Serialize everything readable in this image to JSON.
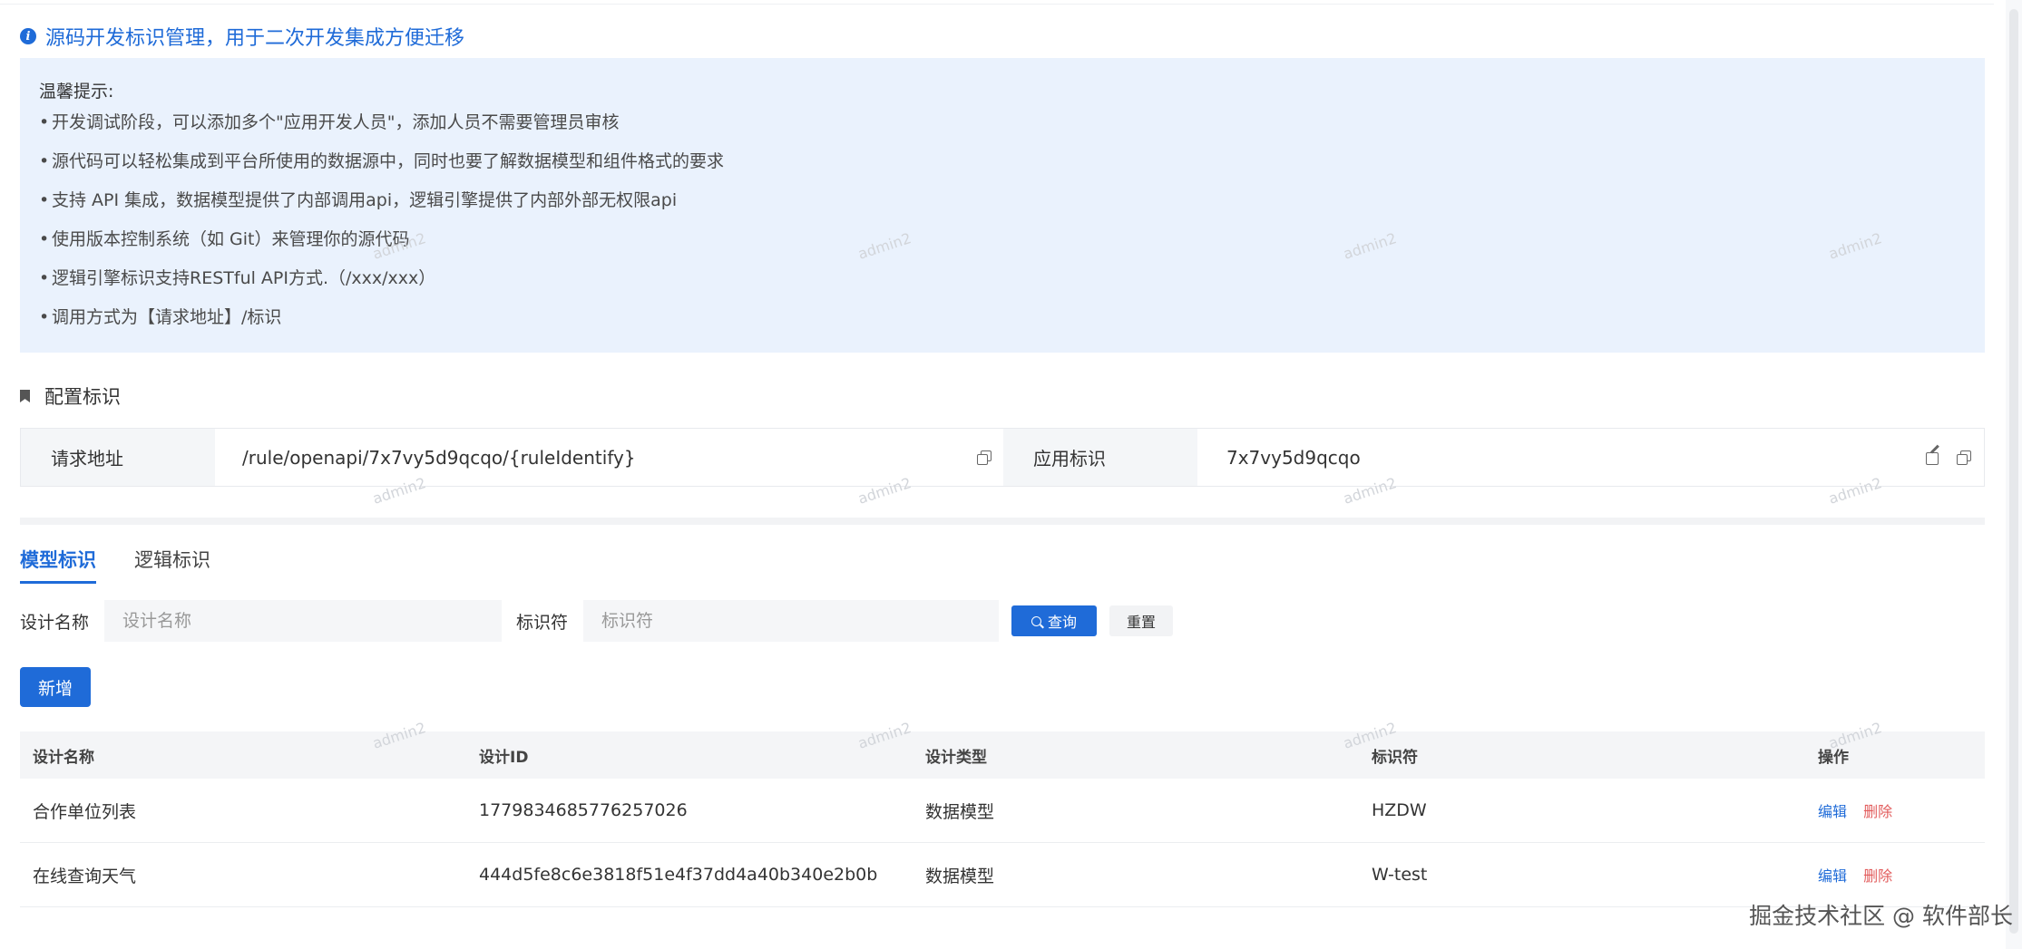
{
  "header": {
    "title": "源码开发标识管理，用于二次开发集成方便迁移"
  },
  "tips": {
    "title": "温馨提示:",
    "bullet": "•",
    "items": [
      "开发调试阶段，可以添加多个\"应用开发人员\"，添加人员不需要管理员审核",
      "源代码可以轻松集成到平台所使用的数据源中，同时也要了解数据模型和组件格式的要求",
      "支持 API 集成，数据模型提供了内部调用api，逻辑引擎提供了内部外部无权限api",
      "使用版本控制系统（如 Git）来管理你的源代码",
      "逻辑引擎标识支持RESTful API方式.（/xxx/xxx）",
      "调用方式为【请求地址】/标识"
    ]
  },
  "config": {
    "section_title": "配置标识",
    "request_label": "请求地址",
    "request_value": "/rule/openapi/7x7vy5d9qcqo/{ruleIdentify}",
    "app_label": "应用标识",
    "app_value": "7x7vy5d9qcqo"
  },
  "tabs": [
    {
      "label": "模型标识",
      "active": true
    },
    {
      "label": "逻辑标识",
      "active": false
    }
  ],
  "filter": {
    "name_label": "设计名称",
    "name_placeholder": "设计名称",
    "id_label": "标识符",
    "id_placeholder": "标识符",
    "query_label": "查询",
    "reset_label": "重置"
  },
  "add_label": "新增",
  "table": {
    "headers": [
      "设计名称",
      "设计ID",
      "设计类型",
      "标识符",
      "操作"
    ],
    "rows": [
      {
        "name": "合作单位列表",
        "id": "1779834685776257026",
        "type": "数据模型",
        "ident": "HZDW"
      },
      {
        "name": "在线查询天气",
        "id": "444d5fe8c6e3818f51e4f37dd4a40b340e2b0b",
        "type": "数据模型",
        "ident": "W-test"
      }
    ],
    "edit_label": "编辑",
    "delete_label": "删除"
  },
  "watermark": "admin2",
  "footer": "掘金技术社区 @ 软件部长",
  "colors": {
    "primary": "#1f6bd8",
    "danger": "#e25c5c",
    "tip_bg": "#eaf2fd"
  }
}
